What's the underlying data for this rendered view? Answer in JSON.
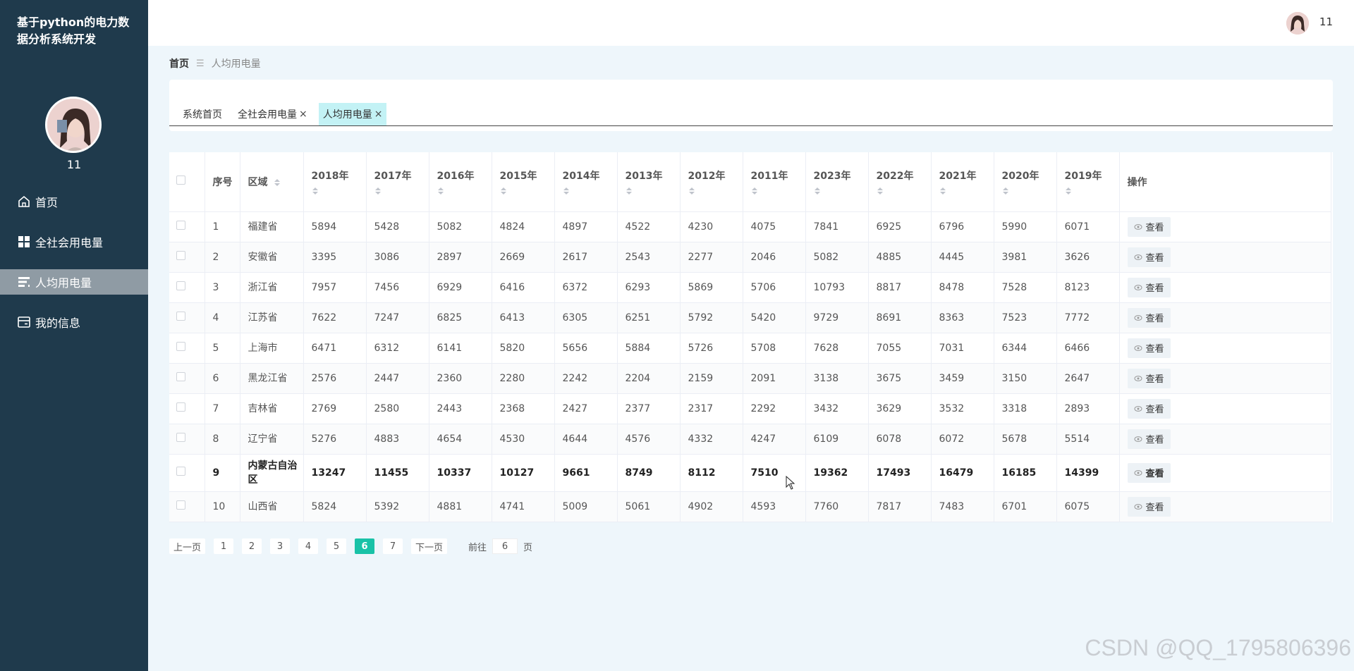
{
  "sidebar": {
    "title": "基于python的电力数据分析系统开发",
    "username": "11",
    "menu": [
      {
        "label": "首页",
        "icon": "home-icon",
        "active": false
      },
      {
        "label": "全社会用电量",
        "icon": "grid-icon",
        "active": false
      },
      {
        "label": "人均用电量",
        "icon": "list-icon",
        "active": true
      },
      {
        "label": "我的信息",
        "icon": "card-icon",
        "active": false
      }
    ]
  },
  "topbar": {
    "username": "11"
  },
  "breadcrumb": {
    "home": "首页",
    "current": "人均用电量"
  },
  "tabs": [
    {
      "label": "系统首页",
      "closable": false,
      "active": false
    },
    {
      "label": "全社会用电量",
      "closable": true,
      "active": false
    },
    {
      "label": "人均用电量",
      "closable": true,
      "active": true
    }
  ],
  "table": {
    "headers": {
      "index": "序号",
      "region": "区域",
      "years": [
        "2018年",
        "2017年",
        "2016年",
        "2015年",
        "2014年",
        "2013年",
        "2012年",
        "2011年",
        "2023年",
        "2022年",
        "2021年",
        "2020年",
        "2019年"
      ],
      "action": "操作"
    },
    "view_label": "查看",
    "rows": [
      {
        "index": "1",
        "region": "福建省",
        "values": [
          "5894",
          "5428",
          "5082",
          "4824",
          "4897",
          "4522",
          "4230",
          "4075",
          "7841",
          "6925",
          "6796",
          "5990",
          "6071"
        ]
      },
      {
        "index": "2",
        "region": "安徽省",
        "values": [
          "3395",
          "3086",
          "2897",
          "2669",
          "2617",
          "2543",
          "2277",
          "2046",
          "5082",
          "4885",
          "4445",
          "3981",
          "3626"
        ]
      },
      {
        "index": "3",
        "region": "浙江省",
        "values": [
          "7957",
          "7456",
          "6929",
          "6416",
          "6372",
          "6293",
          "5869",
          "5706",
          "10793",
          "8817",
          "8478",
          "7528",
          "8123"
        ]
      },
      {
        "index": "4",
        "region": "江苏省",
        "values": [
          "7622",
          "7247",
          "6825",
          "6413",
          "6305",
          "6251",
          "5792",
          "5420",
          "9729",
          "8691",
          "8363",
          "7523",
          "7772"
        ]
      },
      {
        "index": "5",
        "region": "上海市",
        "values": [
          "6471",
          "6312",
          "6141",
          "5820",
          "5656",
          "5884",
          "5726",
          "5708",
          "7628",
          "7055",
          "7031",
          "6344",
          "6466"
        ]
      },
      {
        "index": "6",
        "region": "黑龙江省",
        "values": [
          "2576",
          "2447",
          "2360",
          "2280",
          "2242",
          "2204",
          "2159",
          "2091",
          "3138",
          "3675",
          "3459",
          "3150",
          "2647"
        ]
      },
      {
        "index": "7",
        "region": "吉林省",
        "values": [
          "2769",
          "2580",
          "2443",
          "2368",
          "2427",
          "2377",
          "2317",
          "2292",
          "3432",
          "3629",
          "3532",
          "3318",
          "2893"
        ]
      },
      {
        "index": "8",
        "region": "辽宁省",
        "values": [
          "5276",
          "4883",
          "4654",
          "4530",
          "4644",
          "4576",
          "4332",
          "4247",
          "6109",
          "6078",
          "6072",
          "5678",
          "5514"
        ]
      },
      {
        "index": "9",
        "region": "内蒙古自治区",
        "values": [
          "13247",
          "11455",
          "10337",
          "10127",
          "9661",
          "8749",
          "8112",
          "7510",
          "19362",
          "17493",
          "16479",
          "16185",
          "14399"
        ]
      },
      {
        "index": "10",
        "region": "山西省",
        "values": [
          "5824",
          "5392",
          "4881",
          "4741",
          "5009",
          "5061",
          "4902",
          "4593",
          "7760",
          "7817",
          "7483",
          "6701",
          "6075"
        ]
      }
    ]
  },
  "pagination": {
    "prev": "上一页",
    "pages": [
      "1",
      "2",
      "3",
      "4",
      "5",
      "6",
      "7"
    ],
    "current": "6",
    "next": "下一页",
    "goto_prefix": "前往",
    "goto_value": "6",
    "goto_suffix": "页"
  },
  "watermark": "CSDN @QQ_1795806396",
  "colors": {
    "sidebar_bg": "#1f3a4c",
    "active_menu": "#8f9ba4",
    "active_tab": "#c3f2f5",
    "page_active": "#19c2a7",
    "content_bg": "#eef6fb"
  }
}
